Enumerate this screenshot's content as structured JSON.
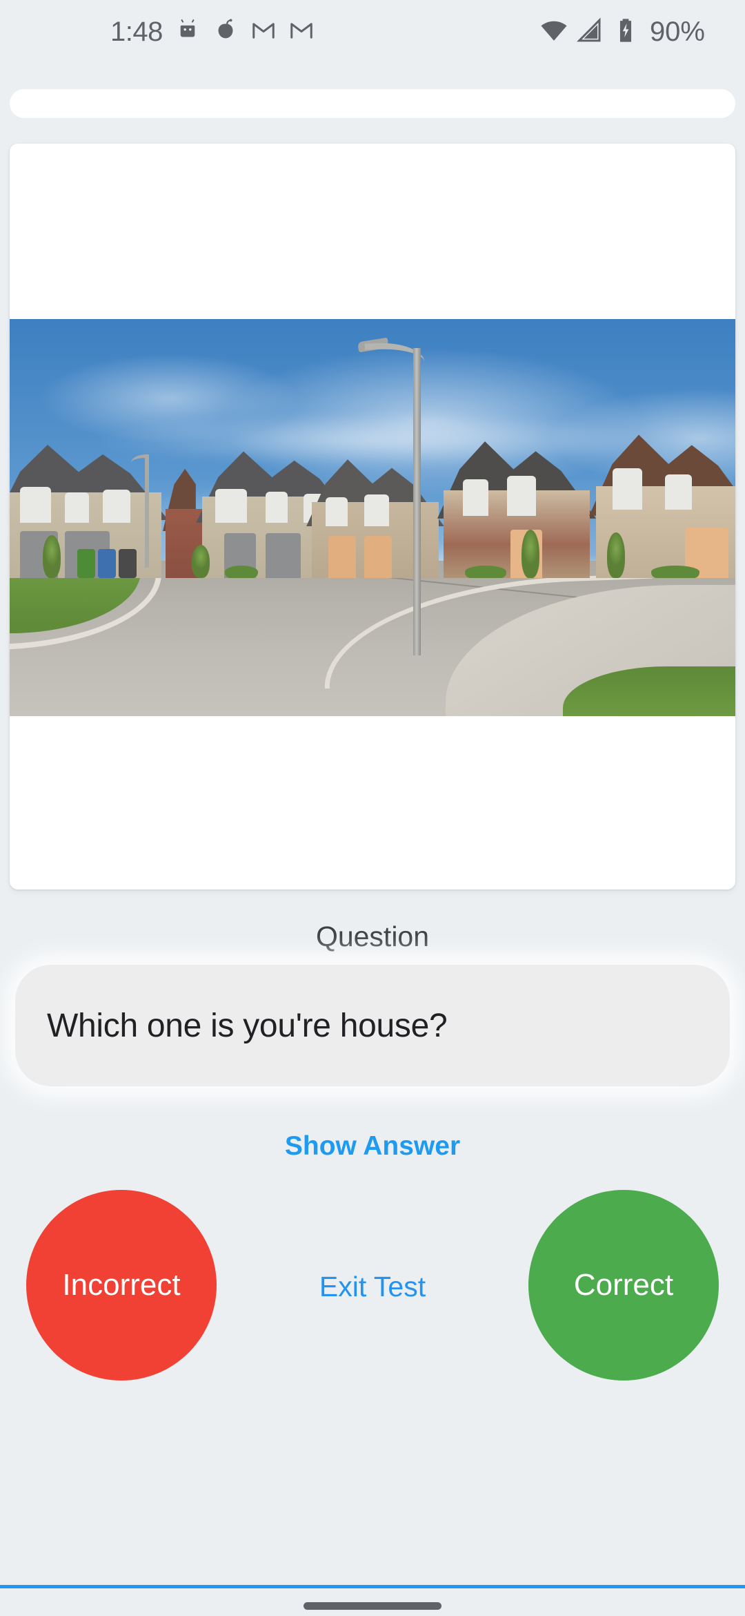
{
  "status_bar": {
    "time": "1:48",
    "battery_percent": "90%",
    "left_icons": [
      "android-icon",
      "acorn-icon",
      "gmail-icon",
      "gmail-icon"
    ],
    "right_icons": [
      "wifi-icon",
      "cellular-signal-icon",
      "battery-charging-icon"
    ]
  },
  "top_bar": {
    "label": ""
  },
  "image_card": {
    "image_alt": "suburban cul-de-sac street lined with two-story brick and stone houses under a blue sky with wispy clouds"
  },
  "question": {
    "label": "Question",
    "text": "Which one is you're house?"
  },
  "actions": {
    "show_answer": "Show Answer",
    "incorrect": "Incorrect",
    "exit_test": "Exit Test",
    "correct": "Correct"
  },
  "colors": {
    "background": "#EBEFF2",
    "card": "#FFFFFF",
    "question_card": "#EDEDED",
    "link_blue": "#2293F0",
    "show_answer_blue": "#1E9BF0",
    "incorrect_red": "#F04134",
    "correct_green": "#4BAB4D",
    "status_gray": "#5F6368",
    "rule_blue": "#2196F3"
  }
}
